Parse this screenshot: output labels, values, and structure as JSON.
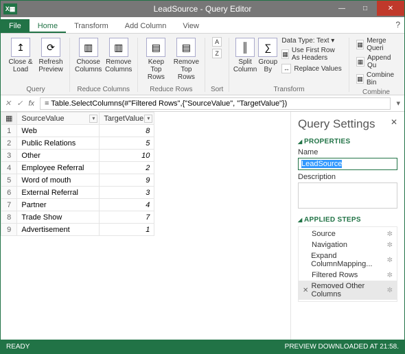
{
  "title": "LeadSource - Query Editor",
  "tabs": {
    "file": "File",
    "home": "Home",
    "transform": "Transform",
    "addColumn": "Add Column",
    "view": "View"
  },
  "ribbon": {
    "closeLoad": "Close &\nLoad",
    "refresh": "Refresh\nPreview",
    "choose": "Choose\nColumns",
    "remove": "Remove\nColumns",
    "keepTop": "Keep Top\nRows",
    "removeTop": "Remove\nTop Rows",
    "sortUp": "↑",
    "sortDown": "↓",
    "split": "Split\nColumn",
    "groupBy": "Group\nBy",
    "dataType": "Data Type: Text ▾",
    "firstRow": "Use First Row As Headers",
    "replace": "Replace Values",
    "merge": "Merge Queri",
    "append": "Append Qu",
    "combine": "Combine Bin",
    "g_query": "Query",
    "g_reduceCols": "Reduce Columns",
    "g_reduceRows": "Reduce Rows",
    "g_sort": "Sort",
    "g_transform": "Transform",
    "g_combine": "Combine"
  },
  "formula": "= Table.SelectColumns(#\"Filtered Rows\",{\"SourceValue\", \"TargetValue\"})",
  "headers": {
    "source": "SourceValue",
    "target": "TargetValue"
  },
  "rows": [
    {
      "n": 1,
      "s": "Web",
      "t": 8
    },
    {
      "n": 2,
      "s": "Public Relations",
      "t": 5
    },
    {
      "n": 3,
      "s": "Other",
      "t": 10
    },
    {
      "n": 4,
      "s": "Employee Referral",
      "t": 2
    },
    {
      "n": 5,
      "s": "Word of mouth",
      "t": 9
    },
    {
      "n": 6,
      "s": "External Referral",
      "t": 3
    },
    {
      "n": 7,
      "s": "Partner",
      "t": 4
    },
    {
      "n": 8,
      "s": "Trade Show",
      "t": 7
    },
    {
      "n": 9,
      "s": "Advertisement",
      "t": 1
    }
  ],
  "settings": {
    "title": "Query Settings",
    "propsLabel": "PROPERTIES",
    "nameLabel": "Name",
    "nameValue": "LeadSource",
    "descLabel": "Description",
    "stepsLabel": "APPLIED STEPS",
    "steps": [
      {
        "label": "Source",
        "gear": true
      },
      {
        "label": "Navigation",
        "gear": true
      },
      {
        "label": "Expand ColumnMapping...",
        "gear": true
      },
      {
        "label": "Filtered Rows",
        "gear": true
      },
      {
        "label": "Removed Other Columns",
        "gear": true,
        "selected": true,
        "x": true
      }
    ]
  },
  "status": {
    "left": "READY",
    "right": "PREVIEW DOWNLOADED AT 21:58."
  }
}
